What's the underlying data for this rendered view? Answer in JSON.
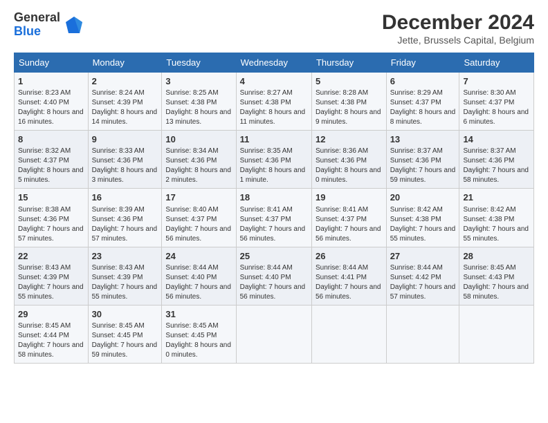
{
  "logo": {
    "general": "General",
    "blue": "Blue"
  },
  "title": "December 2024",
  "subtitle": "Jette, Brussels Capital, Belgium",
  "days_of_week": [
    "Sunday",
    "Monday",
    "Tuesday",
    "Wednesday",
    "Thursday",
    "Friday",
    "Saturday"
  ],
  "weeks": [
    [
      {
        "day": "1",
        "info": "Sunrise: 8:23 AM\nSunset: 4:40 PM\nDaylight: 8 hours and 16 minutes."
      },
      {
        "day": "2",
        "info": "Sunrise: 8:24 AM\nSunset: 4:39 PM\nDaylight: 8 hours and 14 minutes."
      },
      {
        "day": "3",
        "info": "Sunrise: 8:25 AM\nSunset: 4:38 PM\nDaylight: 8 hours and 13 minutes."
      },
      {
        "day": "4",
        "info": "Sunrise: 8:27 AM\nSunset: 4:38 PM\nDaylight: 8 hours and 11 minutes."
      },
      {
        "day": "5",
        "info": "Sunrise: 8:28 AM\nSunset: 4:38 PM\nDaylight: 8 hours and 9 minutes."
      },
      {
        "day": "6",
        "info": "Sunrise: 8:29 AM\nSunset: 4:37 PM\nDaylight: 8 hours and 8 minutes."
      },
      {
        "day": "7",
        "info": "Sunrise: 8:30 AM\nSunset: 4:37 PM\nDaylight: 8 hours and 6 minutes."
      }
    ],
    [
      {
        "day": "8",
        "info": "Sunrise: 8:32 AM\nSunset: 4:37 PM\nDaylight: 8 hours and 5 minutes."
      },
      {
        "day": "9",
        "info": "Sunrise: 8:33 AM\nSunset: 4:36 PM\nDaylight: 8 hours and 3 minutes."
      },
      {
        "day": "10",
        "info": "Sunrise: 8:34 AM\nSunset: 4:36 PM\nDaylight: 8 hours and 2 minutes."
      },
      {
        "day": "11",
        "info": "Sunrise: 8:35 AM\nSunset: 4:36 PM\nDaylight: 8 hours and 1 minute."
      },
      {
        "day": "12",
        "info": "Sunrise: 8:36 AM\nSunset: 4:36 PM\nDaylight: 8 hours and 0 minutes."
      },
      {
        "day": "13",
        "info": "Sunrise: 8:37 AM\nSunset: 4:36 PM\nDaylight: 7 hours and 59 minutes."
      },
      {
        "day": "14",
        "info": "Sunrise: 8:37 AM\nSunset: 4:36 PM\nDaylight: 7 hours and 58 minutes."
      }
    ],
    [
      {
        "day": "15",
        "info": "Sunrise: 8:38 AM\nSunset: 4:36 PM\nDaylight: 7 hours and 57 minutes."
      },
      {
        "day": "16",
        "info": "Sunrise: 8:39 AM\nSunset: 4:36 PM\nDaylight: 7 hours and 57 minutes."
      },
      {
        "day": "17",
        "info": "Sunrise: 8:40 AM\nSunset: 4:37 PM\nDaylight: 7 hours and 56 minutes."
      },
      {
        "day": "18",
        "info": "Sunrise: 8:41 AM\nSunset: 4:37 PM\nDaylight: 7 hours and 56 minutes."
      },
      {
        "day": "19",
        "info": "Sunrise: 8:41 AM\nSunset: 4:37 PM\nDaylight: 7 hours and 56 minutes."
      },
      {
        "day": "20",
        "info": "Sunrise: 8:42 AM\nSunset: 4:38 PM\nDaylight: 7 hours and 55 minutes."
      },
      {
        "day": "21",
        "info": "Sunrise: 8:42 AM\nSunset: 4:38 PM\nDaylight: 7 hours and 55 minutes."
      }
    ],
    [
      {
        "day": "22",
        "info": "Sunrise: 8:43 AM\nSunset: 4:39 PM\nDaylight: 7 hours and 55 minutes."
      },
      {
        "day": "23",
        "info": "Sunrise: 8:43 AM\nSunset: 4:39 PM\nDaylight: 7 hours and 55 minutes."
      },
      {
        "day": "24",
        "info": "Sunrise: 8:44 AM\nSunset: 4:40 PM\nDaylight: 7 hours and 56 minutes."
      },
      {
        "day": "25",
        "info": "Sunrise: 8:44 AM\nSunset: 4:40 PM\nDaylight: 7 hours and 56 minutes."
      },
      {
        "day": "26",
        "info": "Sunrise: 8:44 AM\nSunset: 4:41 PM\nDaylight: 7 hours and 56 minutes."
      },
      {
        "day": "27",
        "info": "Sunrise: 8:44 AM\nSunset: 4:42 PM\nDaylight: 7 hours and 57 minutes."
      },
      {
        "day": "28",
        "info": "Sunrise: 8:45 AM\nSunset: 4:43 PM\nDaylight: 7 hours and 58 minutes."
      }
    ],
    [
      {
        "day": "29",
        "info": "Sunrise: 8:45 AM\nSunset: 4:44 PM\nDaylight: 7 hours and 58 minutes."
      },
      {
        "day": "30",
        "info": "Sunrise: 8:45 AM\nSunset: 4:45 PM\nDaylight: 7 hours and 59 minutes."
      },
      {
        "day": "31",
        "info": "Sunrise: 8:45 AM\nSunset: 4:45 PM\nDaylight: 8 hours and 0 minutes."
      },
      null,
      null,
      null,
      null
    ]
  ]
}
